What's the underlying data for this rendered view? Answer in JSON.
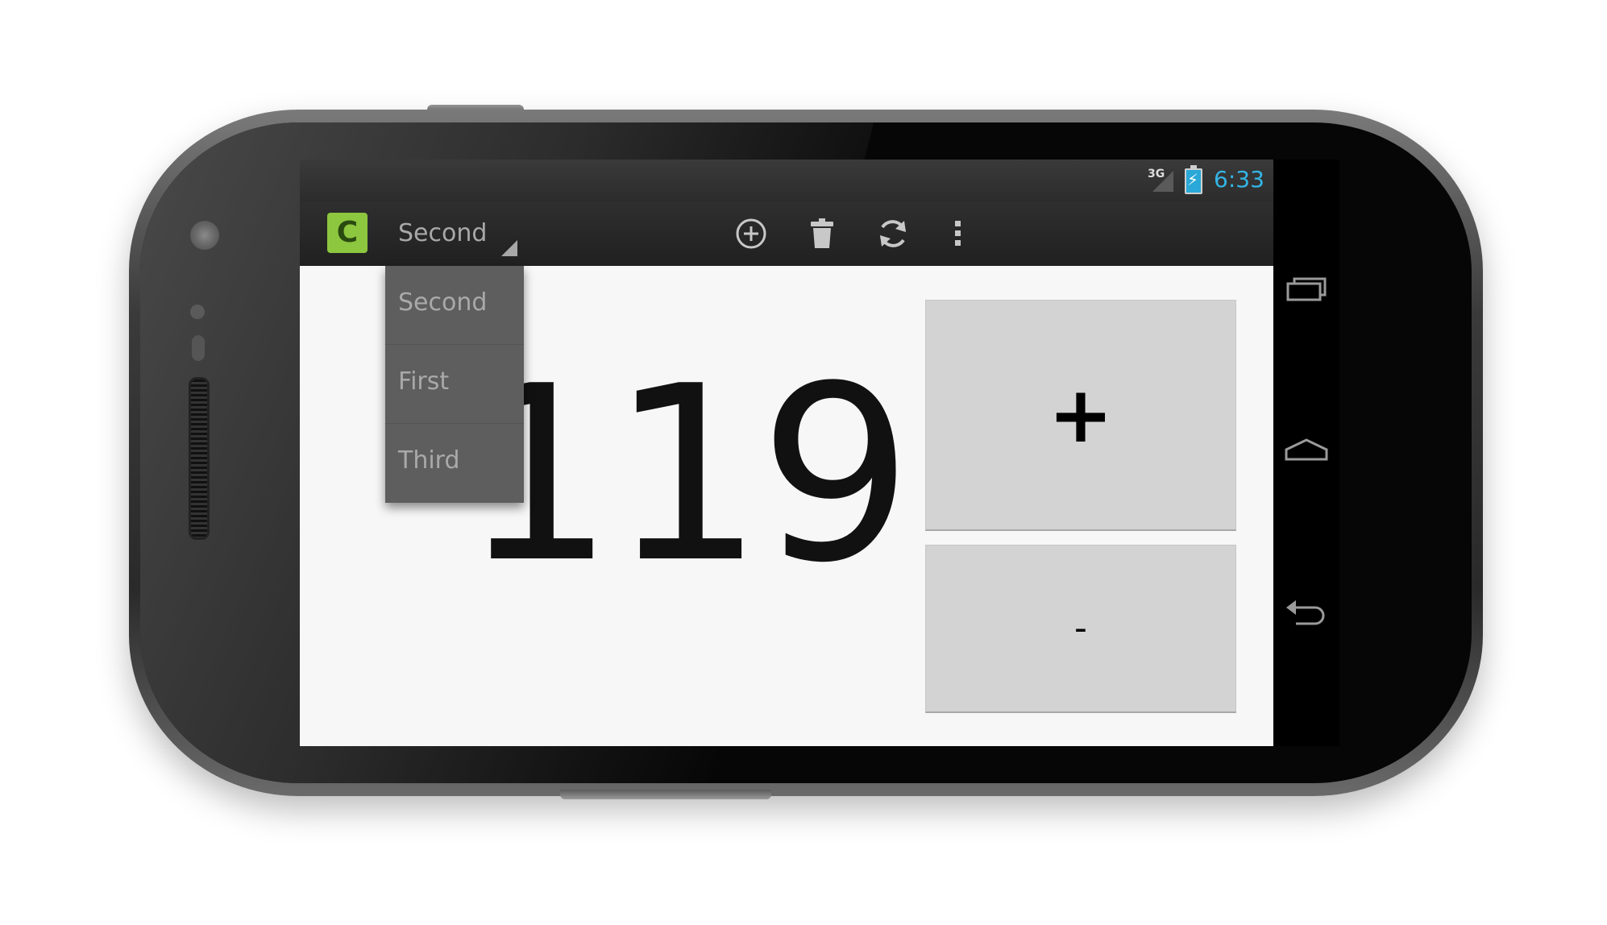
{
  "status_bar": {
    "network": "3G",
    "time": "6:33"
  },
  "action_bar": {
    "app_icon_letter": "C",
    "spinner_selected": "Second",
    "actions": [
      "add-icon",
      "trash-icon",
      "refresh-icon",
      "overflow-menu-icon"
    ]
  },
  "dropdown": {
    "items": [
      {
        "label": "Second"
      },
      {
        "label": "First"
      },
      {
        "label": "Third"
      }
    ]
  },
  "counter": {
    "value": "119"
  },
  "buttons": {
    "increment_label": "+",
    "decrement_label": "-"
  },
  "nav_bar": {
    "icons": [
      "recent-apps-icon",
      "home-icon",
      "back-icon"
    ]
  },
  "colors": {
    "clock": "#33b5e5",
    "app_icon": "#8dc63f",
    "battery": "#2aa8d8",
    "content_bg": "#f7f7f7",
    "button_bg": "#d3d3d3"
  }
}
